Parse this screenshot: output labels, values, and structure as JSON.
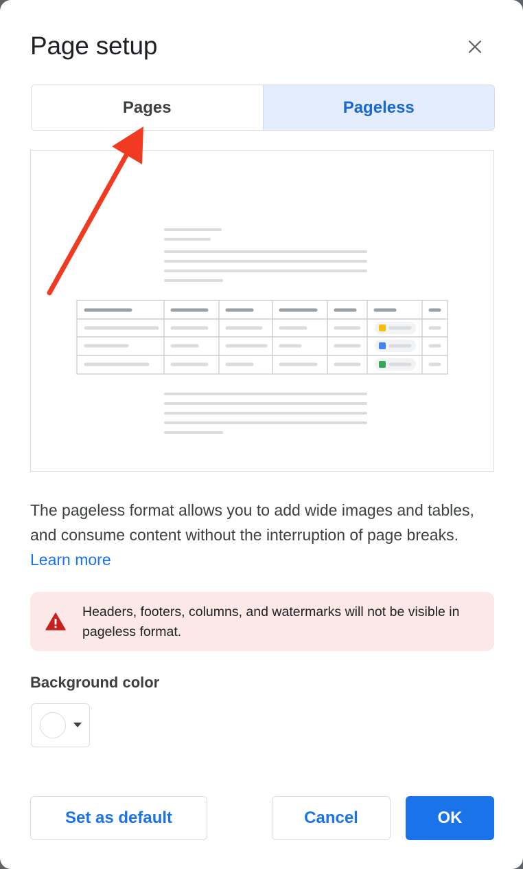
{
  "dialog": {
    "title": "Page setup"
  },
  "tabs": [
    {
      "label": "Pages",
      "selected": false
    },
    {
      "label": "Pageless",
      "selected": true
    }
  ],
  "description": {
    "text": "The pageless format allows you to add wide images and tables, and consume content without the interruption of page breaks.",
    "link": "Learn more"
  },
  "warning": {
    "text": "Headers, footers, columns, and watermarks will not be visible in pageless format.",
    "icon": "warning-triangle-icon"
  },
  "background": {
    "label": "Background color",
    "selected_color": "#ffffff"
  },
  "buttons": {
    "set_default": "Set as default",
    "cancel": "Cancel",
    "ok": "OK"
  },
  "colors": {
    "accent": "#1a73e8",
    "selected_tab_bg": "#e3edfd",
    "warning_bg": "#fce8e6",
    "warning_icon": "#c5221f",
    "annotation_arrow": "#f03b22"
  }
}
